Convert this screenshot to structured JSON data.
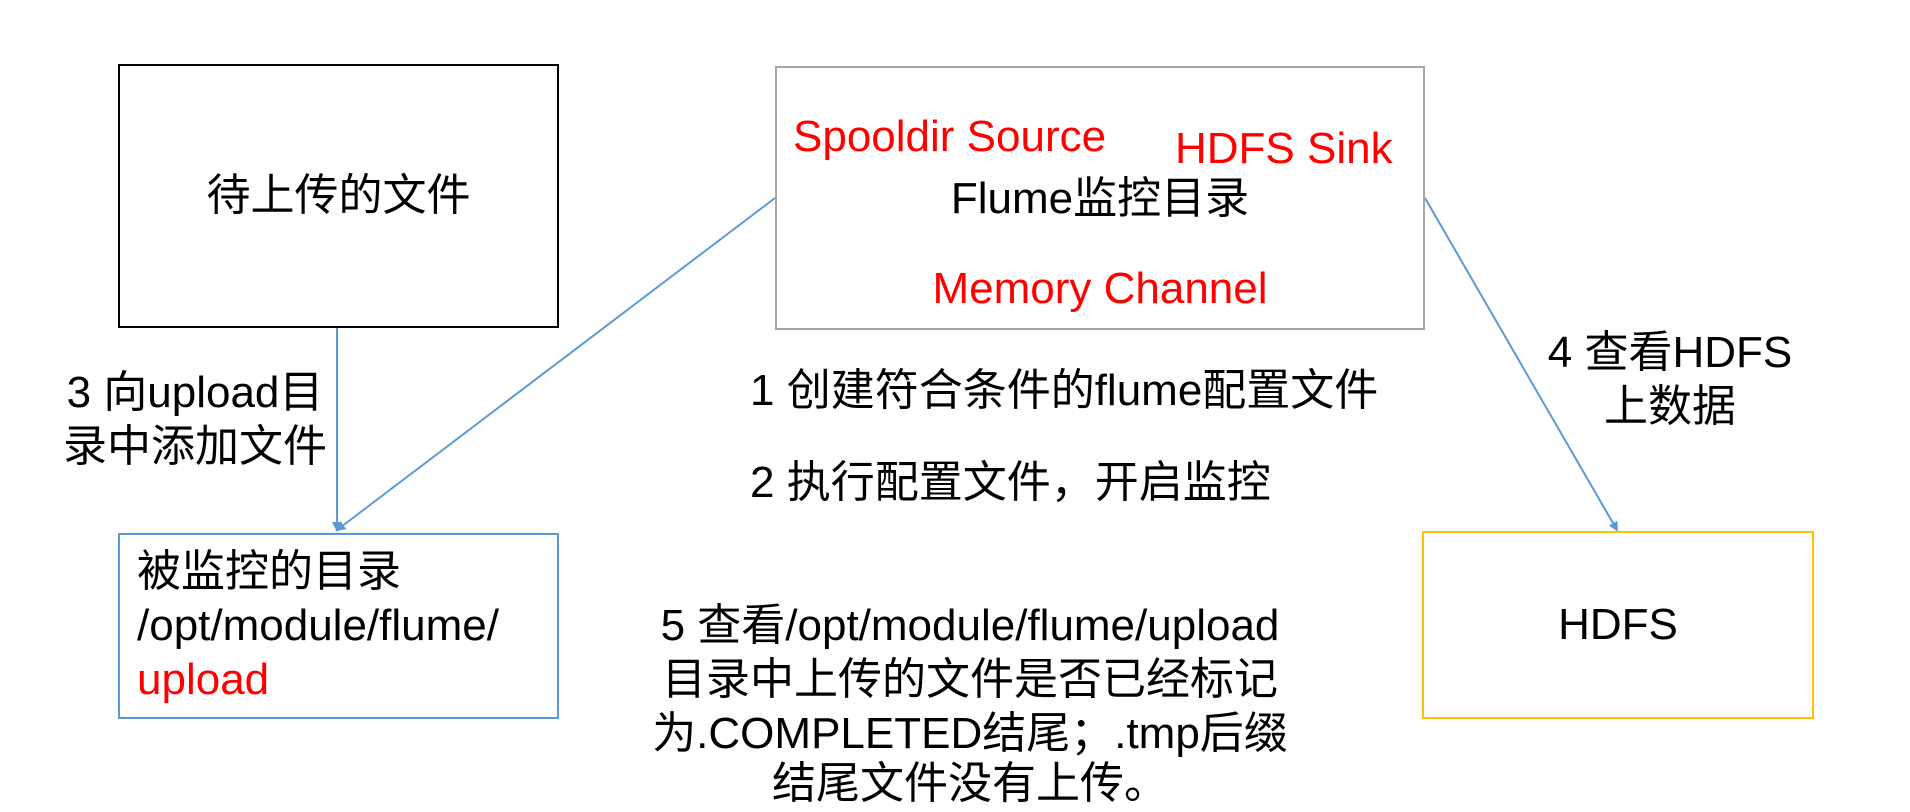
{
  "boxes": {
    "upload_file": {
      "label": "待上传的文件"
    },
    "flume": {
      "title": "Flume监控目录",
      "source": "Spooldir Source",
      "sink": "HDFS Sink",
      "channel": "Memory Channel"
    },
    "monitored_dir": {
      "line1": "被监控的目录",
      "line2": "/opt/module/flume/",
      "line3": "upload"
    },
    "hdfs": {
      "label": "HDFS"
    }
  },
  "steps": {
    "step1": "1 创建符合条件的flume配置文件",
    "step2": "2 执行配置文件，开启监控",
    "step3": [
      "3 向upload目",
      "录中添加文件"
    ],
    "step4": [
      "4 查看HDFS",
      "上数据"
    ],
    "step5": [
      "5 查看/opt/module/flume/upload",
      "目录中上传的文件是否已经标记",
      "为.COMPLETED结尾；.tmp后缀",
      "结尾文件没有上传。"
    ]
  },
  "colors": {
    "box_border": "#000000",
    "flume_border": "#a6a6a6",
    "dir_border": "#5b9bd5",
    "hdfs_border": "#ffc000",
    "arrow": "#5b9bd5",
    "highlight_text": "#ff0000"
  }
}
